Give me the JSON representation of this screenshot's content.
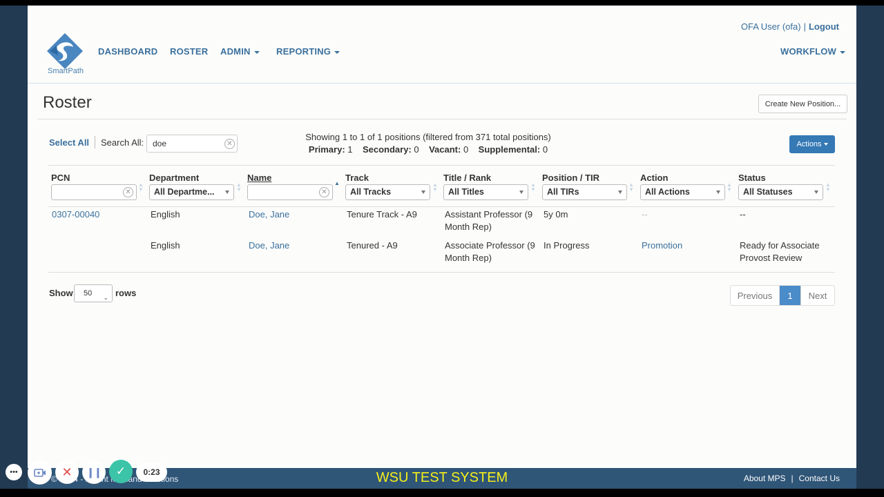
{
  "app": {
    "logo_text": "SmartPath"
  },
  "nav": [
    {
      "label": "DASHBOARD"
    },
    {
      "label": "ROSTER"
    },
    {
      "label": "ADMIN"
    },
    {
      "label": "REPORTING"
    }
  ],
  "workflow_label": "WORKFLOW",
  "user": {
    "name": "OFA User (ofa)",
    "separator": "|",
    "logout": "Logout"
  },
  "page": {
    "title": "Roster",
    "create_button": "Create New Position..."
  },
  "toolbar": {
    "select_all": "Select All",
    "search_label": "Search All:",
    "search_value": "doe",
    "showing_text": "Showing 1 to 1 of 1 positions (filtered from 371 total positions)",
    "primary_label": "Primary:",
    "primary_count": "1",
    "secondary_label": "Secondary:",
    "secondary_count": "0",
    "vacant_label": "Vacant:",
    "vacant_count": "0",
    "supplemental_label": "Supplemental:",
    "supplemental_count": "0",
    "actions_button": "Actions"
  },
  "table": {
    "columns": [
      {
        "label": "PCN"
      },
      {
        "label": "Department",
        "filter": "All Departme..."
      },
      {
        "label": "Name"
      },
      {
        "label": "Track",
        "filter": "All Tracks"
      },
      {
        "label": "Title / Rank",
        "filter": "All Titles"
      },
      {
        "label": "Position / TIR",
        "filter": "All TIRs"
      },
      {
        "label": "Action",
        "filter": "All Actions"
      },
      {
        "label": "Status",
        "filter": "All Statuses"
      }
    ],
    "rows": [
      {
        "pcn": "0307-00040",
        "department": "English",
        "name": "Doe, Jane",
        "track": "Tenure Track - A9",
        "title_line1": "Assistant Professor (9",
        "title_line2": "Month Rep)",
        "tir": "5y 0m",
        "action": "--",
        "status_line1": "--",
        "status_line2": ""
      },
      {
        "pcn": "",
        "department": "English",
        "name": "Doe, Jane",
        "track": "Tenured - A9",
        "title_line1": "Associate Professor (9",
        "title_line2": "Month Rep)",
        "tir": "In Progress",
        "action": "Promotion",
        "status_line1": "Ready for Associate",
        "status_line2": "Provost Review"
      }
    ]
  },
  "paging": {
    "show_label": "Show",
    "rows_value": "50",
    "rows_label": "rows",
    "previous": "Previous",
    "current": "1",
    "next": "Next"
  },
  "footer": {
    "copyright": "© 2024 - Mount Maitland Solutions",
    "system": "WSU TEST SYSTEM",
    "about": "About MPS",
    "separator": "|",
    "contact": "Contact Us"
  },
  "recorder": {
    "time": "0:23",
    "dots": "•••"
  },
  "colors": {
    "brand": "#3a6f9c",
    "footer": "#2f5577",
    "system_text": "#f6ef1a",
    "primary_button": "#3579b5"
  }
}
